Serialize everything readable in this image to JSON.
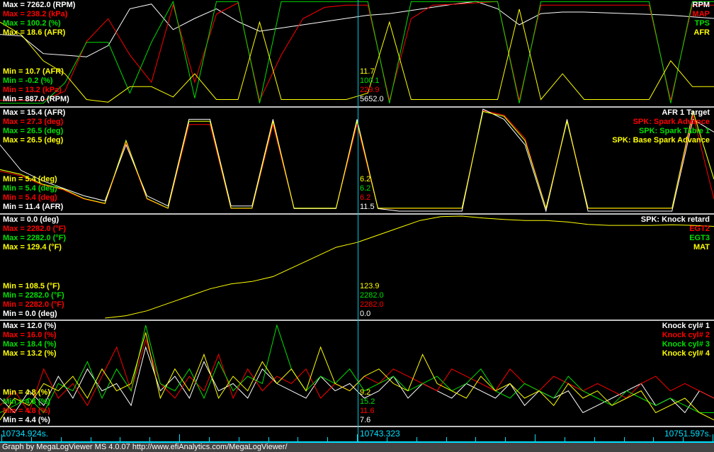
{
  "colors": {
    "white": "#ffffff",
    "red": "#ff0000",
    "green": "#00e000",
    "yellow": "#ffff00",
    "cyan": "#00e0ff"
  },
  "panels": [
    {
      "legend": [
        "RPM",
        "MAP",
        "TPS",
        "AFR"
      ],
      "max": [
        "Max = 7262.0 (RPM)",
        "Max = 238.2 (kPa)",
        "Max = 100.2 (%)",
        "Max = 18.6 (AFR)"
      ],
      "min": [
        "Min = 10.7 (AFR)",
        "Min = -0.2 (%)",
        "Min = 13.2 (kPa)",
        "Min = 887.0 (RPM)"
      ],
      "cursor": [
        "11.7",
        "100.1",
        "229.9",
        "5652.0"
      ],
      "series": [
        {
          "name": "RPM",
          "color": "#ffffff",
          "min": 887,
          "max": 7262,
          "values": [
            5200,
            5100,
            4000,
            3900,
            3800,
            4500,
            6800,
            7100,
            5500,
            6200,
            6800,
            6000,
            5400,
            5600,
            5800,
            6000,
            6200,
            6400,
            6500,
            6700,
            6900,
            7100,
            7262,
            6800,
            5800,
            6500,
            6600,
            6600,
            6550,
            6500,
            6450,
            6400,
            6300,
            6200
          ]
        },
        {
          "name": "MAP",
          "color": "#ff0000",
          "min": 13.2,
          "max": 238.2,
          "values": [
            20,
            20,
            20,
            40,
            150,
            200,
            120,
            60,
            230,
            60,
            210,
            235,
            20,
            120,
            200,
            225,
            230,
            230,
            20,
            200,
            230,
            232,
            235,
            238,
            20,
            230,
            230,
            230,
            230,
            230,
            230,
            20,
            230,
            230
          ]
        },
        {
          "name": "TPS",
          "color": "#00e000",
          "min": -0.2,
          "max": 100.2,
          "values": [
            0,
            0,
            0,
            20,
            60,
            60,
            10,
            60,
            100,
            5,
            100,
            100,
            0,
            100,
            100,
            100,
            100,
            100,
            0,
            100,
            100,
            100,
            100,
            100,
            0,
            100,
            100,
            100,
            100,
            100,
            100,
            0,
            100,
            100
          ]
        },
        {
          "name": "AFR",
          "color": "#ffff00",
          "min": 10.7,
          "max": 18.6,
          "values": [
            17,
            16,
            14,
            13,
            11,
            10.8,
            12,
            12,
            11.2,
            13,
            11,
            11,
            17,
            11,
            11,
            11,
            11,
            11.5,
            17,
            11,
            11,
            11,
            11,
            11,
            18,
            11,
            13,
            11,
            11,
            11,
            11,
            14,
            12,
            12
          ]
        }
      ]
    },
    {
      "legend": [
        "AFR 1 Target",
        "SPK: Spark Advance",
        "SPK: Spark Table 1",
        "SPK: Base Spark Advance"
      ],
      "max": [
        "Max = 15.4 (AFR)",
        "Max = 27.3 (deg)",
        "Max = 26.5 (deg)",
        "Max = 26.5 (deg)"
      ],
      "min": [
        "Min = 5.4 (deg)",
        "Min = 5.4 (deg)",
        "Min = 5.4 (deg)",
        "Min = 11.4 (AFR)"
      ],
      "cursor": [
        "6.2",
        "6.2",
        "6.2",
        "11.5"
      ],
      "series": [
        {
          "name": "SPK: Spark Table 1",
          "color": "#00e000",
          "min": 5.4,
          "max": 26.5,
          "values": [
            14,
            13,
            11,
            10,
            8,
            7,
            20,
            8,
            6,
            24,
            24,
            6,
            6,
            24,
            6,
            6,
            6,
            24,
            6,
            6,
            6,
            6,
            6,
            26,
            25,
            20,
            6,
            24,
            6,
            6,
            6,
            6,
            6,
            26,
            12
          ]
        },
        {
          "name": "SPK: Spark Advance",
          "color": "#ff0000",
          "min": 5.4,
          "max": 27.3,
          "values": [
            14,
            13,
            11,
            10,
            8,
            7,
            20,
            8,
            6,
            24,
            24,
            6,
            6,
            24,
            6,
            6,
            6,
            24,
            6,
            6,
            6,
            6,
            6,
            27,
            26,
            21,
            6,
            25,
            6,
            6,
            6,
            6,
            6,
            26,
            8
          ]
        },
        {
          "name": "AFR 1 Target",
          "color": "#ffffff",
          "min": 11.4,
          "max": 15.4,
          "values": [
            14,
            13,
            12.6,
            12.3,
            12,
            11.8,
            14,
            12,
            11.6,
            15,
            15,
            11.6,
            11.6,
            15,
            11.5,
            11.5,
            11.5,
            15,
            11.5,
            11.4,
            11.4,
            11.4,
            11.4,
            15.4,
            15,
            14,
            11.4,
            15,
            11.4,
            11.4,
            11.4,
            11.4,
            11.4,
            15,
            14.5
          ]
        },
        {
          "name": "SPK: Base Spark Advance",
          "color": "#ffff00",
          "min": 5.4,
          "max": 26.5,
          "values": [
            14,
            13,
            11,
            10,
            8,
            7,
            20,
            8,
            6,
            24,
            24,
            6,
            6,
            24,
            6,
            6,
            6,
            24,
            6,
            6,
            6,
            6,
            6,
            26,
            25,
            20,
            6,
            24,
            6,
            6,
            6,
            6,
            6,
            26,
            12
          ]
        }
      ]
    },
    {
      "legend": [
        "SPK: Knock retard",
        "EGT2",
        "EGT3",
        "MAT"
      ],
      "max": [
        "Max = 0.0 (deg)",
        "Max = 2282.0 (°F)",
        "Max = 2282.0 (°F)",
        "Max = 129.4 (°F)"
      ],
      "min": [
        "Min = 108.5 (°F)",
        "Min = 2282.0 (°F)",
        "Min = 2282.0 (°F)",
        "Min = 0.0 (deg)"
      ],
      "cursor": [
        "123.9",
        "2282.0",
        "2282.0",
        "0.0"
      ],
      "series": [
        {
          "name": "MAT",
          "color": "#ffff00",
          "min": 108.5,
          "max": 129.4,
          "values": [
            null,
            null,
            null,
            null,
            null,
            108.5,
            109,
            110,
            111.5,
            113,
            114.5,
            115.5,
            116,
            117,
            119,
            121,
            123,
            124,
            125.5,
            127,
            128.5,
            129.3,
            129.4,
            129,
            128.7,
            128.5,
            128.5,
            128.2,
            127.7,
            127.5,
            127.5,
            127.5,
            127.6,
            127.5,
            127.3
          ]
        }
      ]
    },
    {
      "legend": [
        "Knock cyl# 1",
        "Knock cyl# 2",
        "Knock cyl# 3",
        "Knock cyl# 4"
      ],
      "max": [
        "Max = 12.0 (%)",
        "Max = 16.0 (%)",
        "Max = 18.4 (%)",
        "Max = 13.2 (%)"
      ],
      "min": [
        "Min = 4.8 (%)",
        "Min = 4.8 (%)",
        "Min = 4.8 (%)",
        "Min = 4.4 (%)"
      ],
      "cursor": [
        "9.2",
        "15.2",
        "11.6",
        "7.6"
      ],
      "series": [
        {
          "name": "Knock cyl# 1",
          "color": "#ffffff",
          "min": 4.4,
          "max": 18.4,
          "values": [
            8,
            6,
            9,
            7,
            11,
            8,
            12,
            9,
            10,
            7,
            15,
            9,
            11,
            8,
            13,
            9,
            10,
            8,
            12,
            10,
            9,
            8,
            11,
            9,
            10,
            8,
            9,
            11,
            8,
            10,
            9,
            8,
            10,
            9,
            8,
            10,
            7,
            9,
            8,
            9,
            6,
            7,
            8,
            9,
            10,
            7,
            8,
            6,
            9,
            8
          ]
        },
        {
          "name": "Knock cyl# 2",
          "color": "#ff0000",
          "min": 4.4,
          "max": 18.4,
          "values": [
            7,
            9,
            6,
            12,
            8,
            10,
            7,
            11,
            15,
            9,
            16,
            10,
            8,
            11,
            9,
            14,
            8,
            12,
            9,
            11,
            10,
            12,
            8,
            10,
            9,
            11,
            10,
            12,
            11,
            10,
            9,
            12,
            11,
            10,
            9,
            12,
            10,
            9,
            11,
            10,
            9,
            10,
            9,
            8,
            10,
            11,
            9,
            10,
            9,
            8
          ]
        },
        {
          "name": "Knock cyl# 3",
          "color": "#00e000",
          "min": 4.4,
          "max": 18.4,
          "values": [
            6,
            7,
            8,
            6,
            10,
            9,
            13,
            8,
            12,
            9,
            18,
            10,
            9,
            12,
            8,
            13,
            9,
            11,
            10,
            18,
            12,
            9,
            11,
            10,
            12,
            9,
            10,
            11,
            9,
            10,
            11,
            9,
            10,
            12,
            9,
            8,
            10,
            9,
            8,
            11,
            9,
            8,
            7,
            9,
            8,
            7,
            8,
            7,
            6,
            6
          ]
        },
        {
          "name": "Knock cyl# 4",
          "color": "#ffff00",
          "min": 4.4,
          "max": 18.4,
          "values": [
            5,
            8,
            7,
            10,
            9,
            11,
            8,
            12,
            9,
            10,
            17,
            8,
            12,
            9,
            14,
            8,
            11,
            9,
            13,
            10,
            12,
            9,
            15,
            10,
            9,
            11,
            12,
            10,
            9,
            14,
            10,
            9,
            8,
            11,
            9,
            10,
            8,
            9,
            7,
            10,
            8,
            9,
            7,
            8,
            9,
            6,
            7,
            8,
            6,
            5
          ]
        }
      ]
    }
  ],
  "axis": {
    "start": "10734.924s.",
    "cursor": "10743.323",
    "end": "10751.597s."
  },
  "footer": "Graph by MegaLogViewer MS 4.0.07 http://www.efiAnalytics.com/MegaLogViewer/"
}
